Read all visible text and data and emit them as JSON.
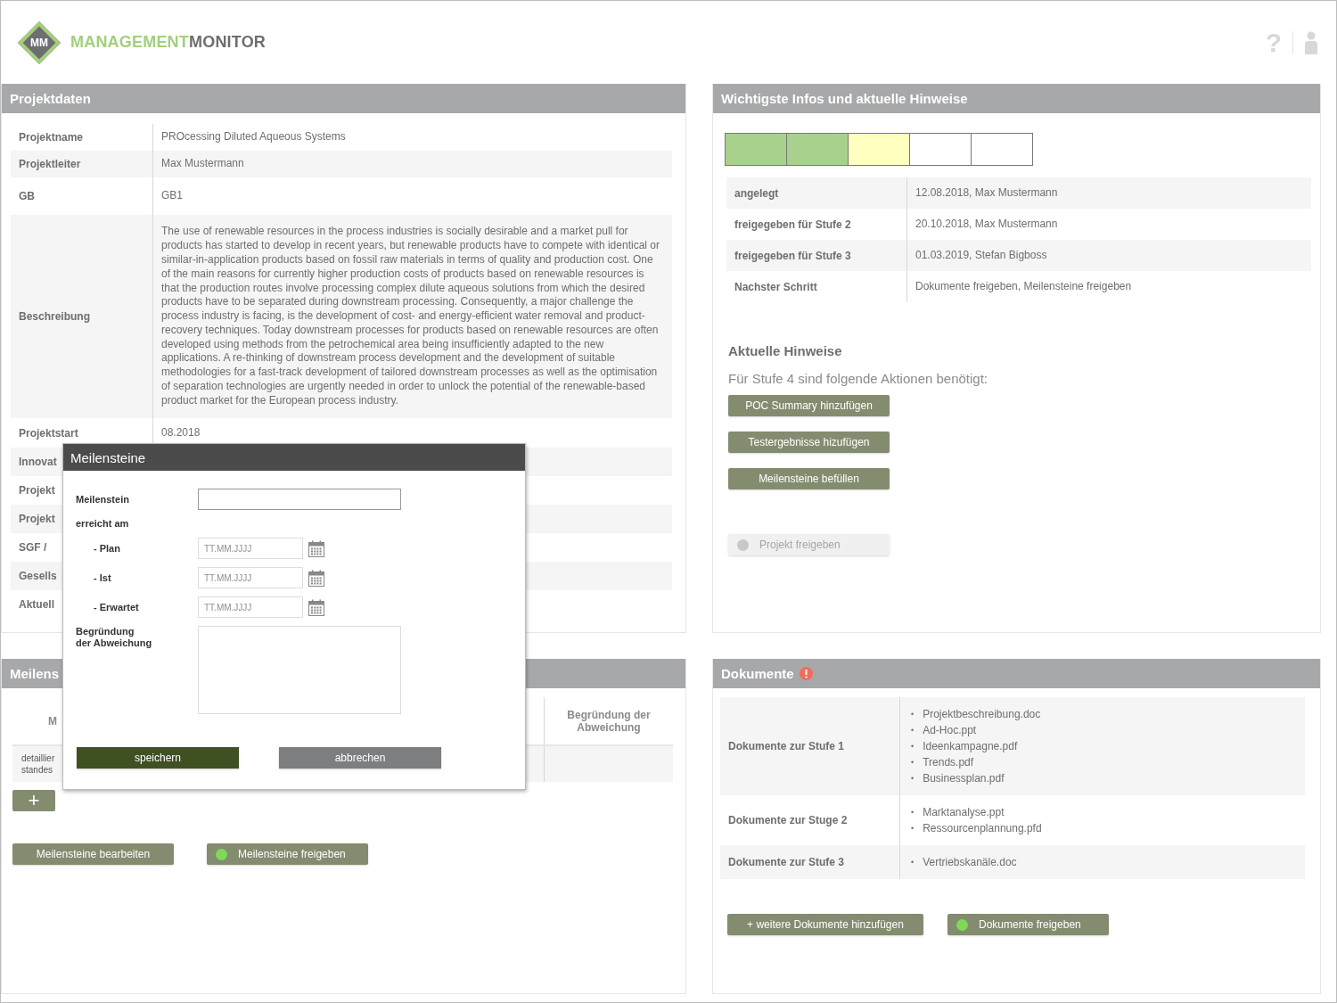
{
  "logo": {
    "badge": "MM",
    "name_first": "MANAGEMENT",
    "name_second": "MONITOR"
  },
  "header_help": "?",
  "project": {
    "title": "Projektdaten",
    "rows": [
      {
        "label": "Projektname",
        "value": "PROcessing Diluted Aqueous Systems"
      },
      {
        "label": "Projektleiter",
        "value": "Max Mustermann"
      },
      {
        "label": "GB",
        "value": "GB1"
      },
      {
        "label": "Beschreibung",
        "value": "The use of renewable resources in the process industries is socially desirable and a market pull for products has started to develop in recent years, but renewable products have to compete with identical or similar-in-application products based on fossil raw materials in terms of quality and production cost. One of the main reasons for currently higher production costs of products based on renewable resources is that the production routes involve processing complex dilute aqueous solutions from which the desired products have to be separated during downstream processing. Consequently, a major challenge the process industry is facing, is the development of cost- and energy-efficient water removal and product-recovery techniques. Today downstream processes for products based on renewable resources are often developed using methods from the petrochemical area being insufficiently adapted to the new applications. A re-thinking of downstream process development and the development of suitable methodologies for a fast-track development of tailored downstream processes as well as the optimisation of separation technologies are urgently needed in order to unlock the potential of the renewable-based product market for the European process industry."
      },
      {
        "label": "Projektstart",
        "value": "08.2018"
      },
      {
        "label": "Innovat"
      },
      {
        "label": "Projekt"
      },
      {
        "label": "Projekt"
      },
      {
        "label": "SGF /"
      },
      {
        "label": "Gesells"
      },
      {
        "label": "Aktuell"
      }
    ]
  },
  "milestones": {
    "title": "Meilens",
    "columns": [
      "M",
      "Begründung der Abweichung"
    ],
    "rows": [
      {
        "cell": "detaillier standes"
      }
    ],
    "add": "+",
    "buttons": [
      {
        "label": "Meilensteine bearbeiten",
        "indicator": false,
        "disabled": false
      },
      {
        "label": "Meilensteine freigeben",
        "indicator": true,
        "disabled": false
      }
    ]
  },
  "dialog": {
    "title": "Meilensteine",
    "name_label": "Meilenstein",
    "reached_label": "erreicht am",
    "dates": [
      {
        "label": "- Plan",
        "placeholder": "TT.MM.JJJJ"
      },
      {
        "label": "- Ist",
        "placeholder": "TT.MM.JJJJ"
      },
      {
        "label": "- Erwartet",
        "placeholder": "TT.MM.JJJJ"
      }
    ],
    "reason_label": [
      "Begründung",
      "der Abweichung"
    ],
    "buttons": [
      {
        "label": "speichern",
        "kind": "primary"
      },
      {
        "label": "abbrechen",
        "kind": "secondary"
      }
    ]
  },
  "info": {
    "title": "Wichtigste Infos und aktuelle Hinweise",
    "stages": [
      {
        "color": "#a9d18e"
      },
      {
        "color": "#a9d18e"
      },
      {
        "color": "#ffffbf"
      },
      {
        "color": "#ffffff"
      },
      {
        "color": "#ffffff"
      }
    ],
    "rows": [
      {
        "label": "angelegt",
        "value": "12.08.2018, Max Mustermann"
      },
      {
        "label": "freigegeben für Stufe 2",
        "value": "20.10.2018, Max Mustermann"
      },
      {
        "label": "freigegeben für Stufe 3",
        "value": "01.03.2019, Stefan Bigboss"
      },
      {
        "label": "Nachster Schritt",
        "value": "Dokumente freigeben, Meilensteine freigeben"
      }
    ],
    "notes_title": "Aktuelle Hinweise",
    "notes_text": "Für Stufe 4 sind folgende Aktionen benötigt:",
    "actions": [
      {
        "label": "POC Summary hinzufügen",
        "indicator": false,
        "disabled": false
      },
      {
        "label": "Testergebnisse hizufügen",
        "indicator": false,
        "disabled": false
      },
      {
        "label": "Meilensteine befüllen",
        "indicator": false,
        "disabled": false
      }
    ],
    "release": {
      "label": "Projekt freigeben",
      "indicator": true,
      "disabled": true
    }
  },
  "documents": {
    "title": "Dokumente",
    "alert": true,
    "bullet": "•",
    "rows": [
      {
        "label": "Dokumente zur Stufe 1",
        "files": [
          "Projektbeschreibung.doc",
          "Ad-Hoc.ppt",
          "Ideenkampagne.pdf",
          "Trends.pdf",
          "Businessplan.pdf"
        ]
      },
      {
        "label": "Dokumente zur Stuge 2",
        "files": [
          "Marktanalyse.ppt",
          "Ressourcenplannung.pfd"
        ]
      },
      {
        "label": "Dokumente zur Stufe 3",
        "files": [
          "Vertriebskanäle.doc"
        ]
      }
    ],
    "buttons": [
      {
        "label": "+  weitere Dokumente hinzufügen",
        "indicator": false,
        "disabled": false
      },
      {
        "label": "Dokumente freigeben",
        "indicator": true,
        "disabled": false
      }
    ]
  }
}
